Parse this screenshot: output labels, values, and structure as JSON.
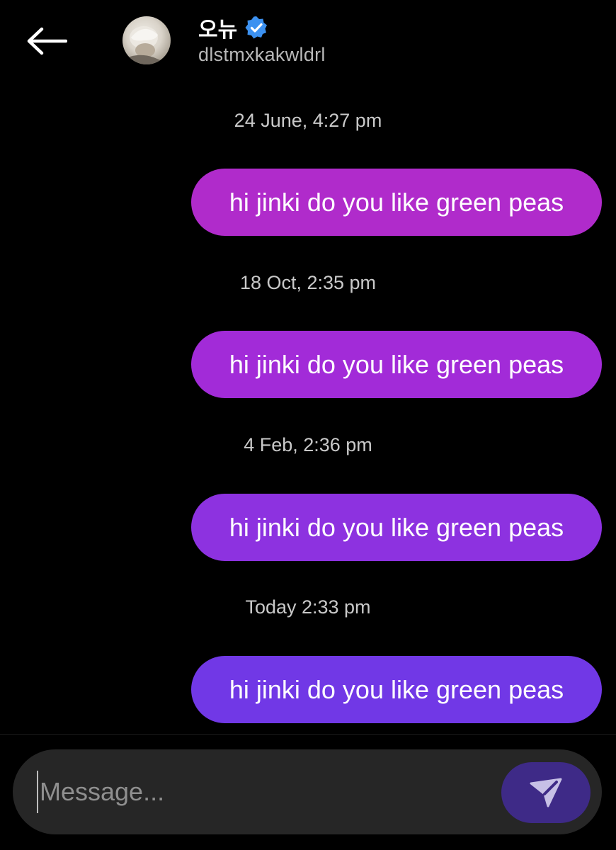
{
  "header": {
    "back_icon": "arrow-left-icon",
    "avatar_icon": "profile-avatar",
    "name": "오뉴",
    "verified_icon": "verified-badge-icon",
    "verified_color": "#3c91f0",
    "handle": "dlstmxkakwldrl"
  },
  "messages": [
    {
      "timestamp": "24 June, 4:27 pm",
      "text": "hi jinki do you like green peas",
      "color": "#b02bcb"
    },
    {
      "timestamp": "18 Oct, 2:35 pm",
      "text": "hi jinki do you like green peas",
      "color": "#a22bd8"
    },
    {
      "timestamp": "4 Feb, 2:36 pm",
      "text": "hi jinki do you like green peas",
      "color": "#8d32e0"
    },
    {
      "timestamp": "Today 2:33 pm",
      "text": "hi jinki do you like green peas",
      "color": "#7138e6"
    }
  ],
  "composer": {
    "placeholder": "Message...",
    "value": "",
    "send_icon": "send-icon",
    "send_color": "#3e2a87"
  }
}
